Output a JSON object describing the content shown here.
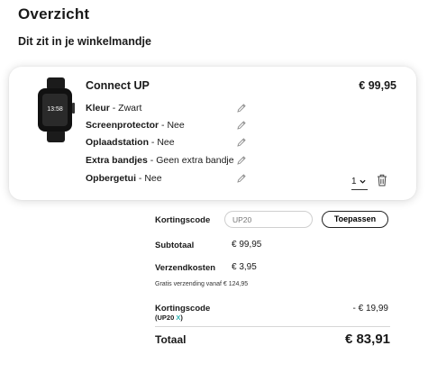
{
  "page": {
    "title": "Overzicht",
    "subtitle": "Dit zit in je winkelmandje"
  },
  "product": {
    "name": "Connect UP",
    "price": "€ 99,95",
    "image_alt": "smartwatch",
    "watch_time": "13:58",
    "options": [
      {
        "label": "Kleur",
        "value": " - Zwart"
      },
      {
        "label": "Screenprotector",
        "value": " - Nee"
      },
      {
        "label": "Oplaadstation",
        "value": " - Nee"
      },
      {
        "label": "Extra bandjes",
        "value": " - Geen extra bandje"
      },
      {
        "label": "Opbergetui",
        "value": " - Nee"
      }
    ],
    "quantity": "1"
  },
  "coupon": {
    "label": "Kortingscode",
    "value": "UP20",
    "button": "Toepassen"
  },
  "summary": {
    "subtotal_label": "Subtotaal",
    "subtotal_value": "€ 99,95",
    "shipping_label": "Verzendkosten",
    "shipping_value": "€ 3,95",
    "shipping_note": "Gratis verzending vanaf € 124,95",
    "discount_label": "Kortingscode",
    "discount_code_prefix": "(UP20 ",
    "discount_code_remove": "X",
    "discount_code_suffix": ")",
    "discount_value": "- € 19,99",
    "total_label": "Totaal",
    "total_value": "€ 83,91"
  },
  "colors": {
    "accent": "#2bb3b3",
    "text": "#1a1a1a"
  },
  "icons": {
    "edit": "pencil-icon",
    "delete": "trash-icon",
    "dropdown": "chevron-down-icon"
  }
}
